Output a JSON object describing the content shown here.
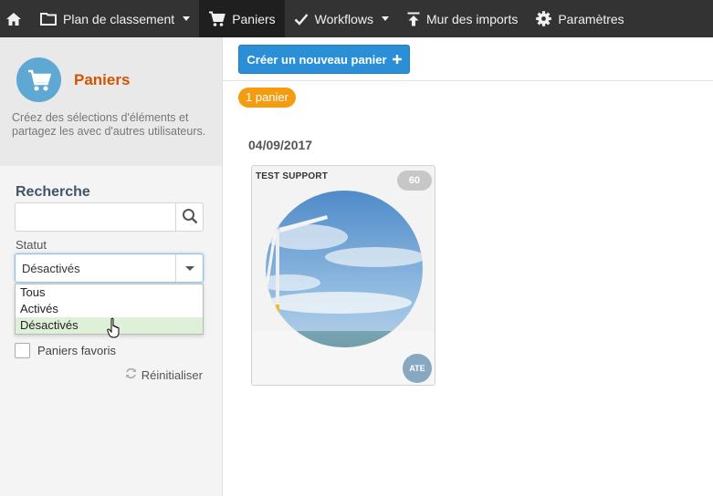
{
  "nav": {
    "home_icon": "home-icon",
    "items": [
      {
        "label": "Plan de classement",
        "icon": "folder-icon",
        "has_dropdown": true
      },
      {
        "label": "Paniers",
        "icon": "cart-icon",
        "active": true
      },
      {
        "label": "Workflows",
        "icon": "check-icon",
        "has_dropdown": true
      },
      {
        "label": "Mur des imports",
        "icon": "upload-icon"
      },
      {
        "label": "Paramètres",
        "icon": "gear-icon"
      }
    ]
  },
  "sidebar": {
    "title": "Paniers",
    "description": "Créez des sélections d'éléments et partagez les avec d'autres utilisateurs.",
    "search": {
      "label": "Recherche",
      "value": "",
      "placeholder": ""
    },
    "statut": {
      "label": "Statut",
      "selected": "Désactivés",
      "options": [
        "Tous",
        "Activés",
        "Désactivés"
      ],
      "highlighted": "Désactivés"
    },
    "favorites_label": "Paniers favoris",
    "reset_label": "Réinitialiser"
  },
  "main": {
    "create_button_label": "Créer un nouveau panier",
    "count_badge": "1 panier",
    "groups": [
      {
        "date": "04/09/2017",
        "cards": [
          {
            "title": "TEST SUPPORT",
            "count": "60",
            "owner": "ATE"
          }
        ]
      }
    ]
  },
  "colors": {
    "nav_bg": "#333333",
    "accent_blue": "#2a8fd6",
    "title_orange": "#d35400",
    "badge_orange": "#f39c12",
    "highlight_green": "#dff0d8"
  }
}
